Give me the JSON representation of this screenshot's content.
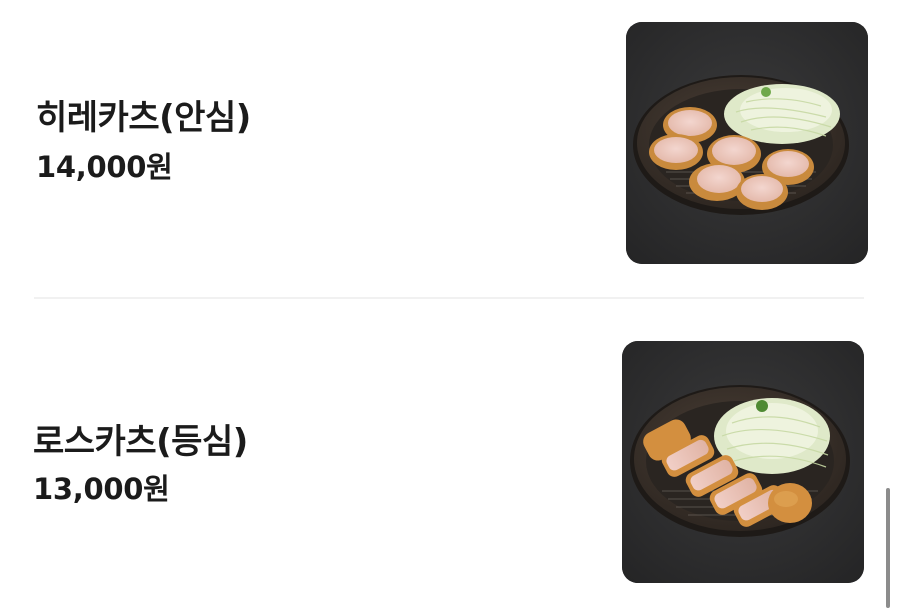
{
  "menu": {
    "items": [
      {
        "name": "히레카츠(안심)",
        "price": "14,000원",
        "image_icon": "hire-katsu-plate-photo"
      },
      {
        "name": "로스카츠(등심)",
        "price": "13,000원",
        "image_icon": "rosu-katsu-plate-photo"
      }
    ]
  },
  "colors": {
    "background": "#ffffff",
    "text": "#1b1b1b",
    "photo_bg": "#2e2e2f",
    "divider": "#f1f1f1",
    "scrollbar": "#8c8c8c"
  }
}
